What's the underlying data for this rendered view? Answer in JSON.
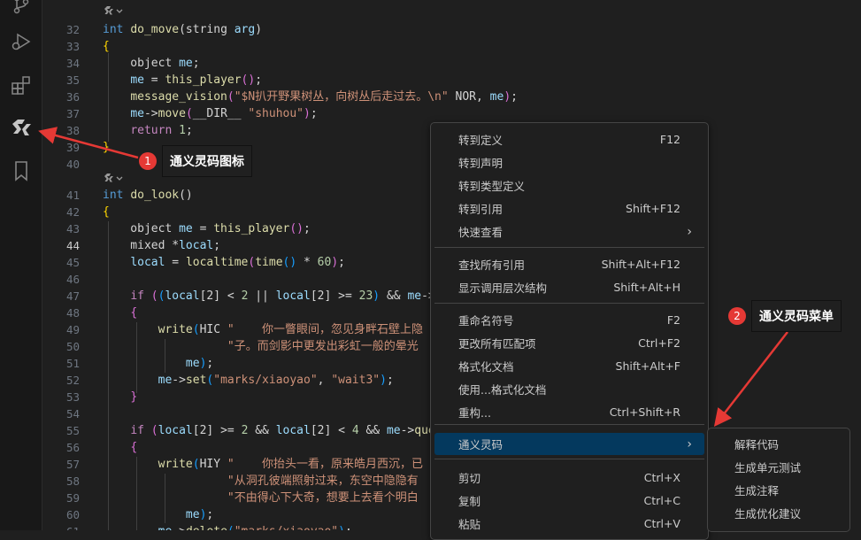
{
  "callouts": [
    {
      "number": "1",
      "text": "通义灵码图标"
    },
    {
      "number": "2",
      "text": "通义灵码菜单"
    }
  ],
  "code": {
    "lines": [
      {
        "n": "",
        "lens": true,
        "tokens": []
      },
      {
        "n": "32",
        "tokens": [
          [
            "int",
            "kw"
          ],
          [
            " ",
            "txt"
          ],
          [
            "do_move",
            "fn"
          ],
          [
            "(string ",
            "txt"
          ],
          [
            "arg",
            "var"
          ],
          [
            ")",
            "txt"
          ]
        ]
      },
      {
        "n": "33",
        "tokens": [
          [
            "{",
            "br"
          ]
        ]
      },
      {
        "n": "34",
        "tokens": [
          [
            "    object ",
            "txt"
          ],
          [
            "me",
            "var"
          ],
          [
            ";",
            "txt"
          ]
        ]
      },
      {
        "n": "35",
        "tokens": [
          [
            "    ",
            "txt"
          ],
          [
            "me",
            "var"
          ],
          [
            " = ",
            "txt"
          ],
          [
            "this_player",
            "fn"
          ],
          [
            "()",
            "br2"
          ],
          [
            ";",
            "txt"
          ]
        ]
      },
      {
        "n": "36",
        "tokens": [
          [
            "    ",
            "txt"
          ],
          [
            "message_vision",
            "fn"
          ],
          [
            "(",
            "br2"
          ],
          [
            "\"$N扒开野果树丛，向树丛后走过去。\\n\"",
            "str"
          ],
          [
            " NOR, ",
            "txt"
          ],
          [
            "me",
            "var"
          ],
          [
            ")",
            "br2"
          ],
          [
            ";",
            "txt"
          ]
        ]
      },
      {
        "n": "37",
        "tokens": [
          [
            "    ",
            "txt"
          ],
          [
            "me",
            "var"
          ],
          [
            "->",
            "txt"
          ],
          [
            "move",
            "fn"
          ],
          [
            "(",
            "br2"
          ],
          [
            "__DIR__ ",
            "txt"
          ],
          [
            "\"shuhou\"",
            "str"
          ],
          [
            ")",
            "br2"
          ],
          [
            ";",
            "txt"
          ]
        ]
      },
      {
        "n": "38",
        "tokens": [
          [
            "    ",
            "txt"
          ],
          [
            "return",
            "pur"
          ],
          [
            " ",
            "txt"
          ],
          [
            "1",
            "num"
          ],
          [
            ";",
            "txt"
          ]
        ]
      },
      {
        "n": "39",
        "tokens": [
          [
            "}",
            "br"
          ]
        ]
      },
      {
        "n": "40",
        "tokens": []
      },
      {
        "n": "",
        "lens": true,
        "tokens": []
      },
      {
        "n": "41",
        "tokens": [
          [
            "int",
            "kw"
          ],
          [
            " ",
            "txt"
          ],
          [
            "do_look",
            "fn"
          ],
          [
            "()",
            "txt"
          ]
        ]
      },
      {
        "n": "42",
        "tokens": [
          [
            "{",
            "br"
          ]
        ]
      },
      {
        "n": "43",
        "tokens": [
          [
            "    object ",
            "txt"
          ],
          [
            "me",
            "var"
          ],
          [
            " = ",
            "txt"
          ],
          [
            "this_player",
            "fn"
          ],
          [
            "()",
            "br2"
          ],
          [
            ";",
            "txt"
          ]
        ]
      },
      {
        "n": "44",
        "active": true,
        "tokens": [
          [
            "    mixed *",
            "txt"
          ],
          [
            "local",
            "var"
          ],
          [
            ";",
            "txt"
          ]
        ]
      },
      {
        "n": "45",
        "tokens": [
          [
            "    ",
            "txt"
          ],
          [
            "local",
            "var"
          ],
          [
            " = ",
            "txt"
          ],
          [
            "localtime",
            "fn"
          ],
          [
            "(",
            "br2"
          ],
          [
            "time",
            "fn"
          ],
          [
            "()",
            "br3"
          ],
          [
            " * ",
            "txt"
          ],
          [
            "60",
            "num"
          ],
          [
            ")",
            "br2"
          ],
          [
            ";",
            "txt"
          ]
        ]
      },
      {
        "n": "46",
        "tokens": []
      },
      {
        "n": "47",
        "tokens": [
          [
            "    ",
            "txt"
          ],
          [
            "if",
            "pur"
          ],
          [
            " ",
            "txt"
          ],
          [
            "(",
            "br2"
          ],
          [
            "(",
            "br3"
          ],
          [
            "local",
            "var"
          ],
          [
            "[2]",
            "txt"
          ],
          [
            " < ",
            "txt"
          ],
          [
            "2",
            "num"
          ],
          [
            " || ",
            "txt"
          ],
          [
            "local",
            "var"
          ],
          [
            "[2]",
            "txt"
          ],
          [
            " >= ",
            "txt"
          ],
          [
            "23",
            "num"
          ],
          [
            ")",
            "br3"
          ],
          [
            " && ",
            "txt"
          ],
          [
            "me",
            "var"
          ],
          [
            "->",
            "txt"
          ]
        ]
      },
      {
        "n": "48",
        "tokens": [
          [
            "    ",
            "txt"
          ],
          [
            "{",
            "br2"
          ]
        ]
      },
      {
        "n": "49",
        "tokens": [
          [
            "        ",
            "txt"
          ],
          [
            "write",
            "fn"
          ],
          [
            "(",
            "br3"
          ],
          [
            "HIC ",
            "txt"
          ],
          [
            "\"    你一瞥眼间，忽见身畔石壁上隐",
            "str"
          ]
        ]
      },
      {
        "n": "50",
        "tokens": [
          [
            "                  ",
            "txt"
          ],
          [
            "\"子。而剑影中更发出彩虹一般的晕光",
            "str"
          ]
        ]
      },
      {
        "n": "51",
        "tokens": [
          [
            "            ",
            "txt"
          ],
          [
            "me",
            "var"
          ],
          [
            ")",
            "br3"
          ],
          [
            ";",
            "txt"
          ]
        ]
      },
      {
        "n": "52",
        "tokens": [
          [
            "        ",
            "txt"
          ],
          [
            "me",
            "var"
          ],
          [
            "->",
            "txt"
          ],
          [
            "set",
            "fn"
          ],
          [
            "(",
            "br3"
          ],
          [
            "\"marks/xiaoyao\"",
            "str"
          ],
          [
            ", ",
            "txt"
          ],
          [
            "\"wait3\"",
            "str"
          ],
          [
            ")",
            "br3"
          ],
          [
            ";",
            "txt"
          ]
        ]
      },
      {
        "n": "53",
        "tokens": [
          [
            "    ",
            "txt"
          ],
          [
            "}",
            "br2"
          ]
        ]
      },
      {
        "n": "54",
        "tokens": []
      },
      {
        "n": "55",
        "tokens": [
          [
            "    ",
            "txt"
          ],
          [
            "if",
            "pur"
          ],
          [
            " ",
            "txt"
          ],
          [
            "(",
            "br2"
          ],
          [
            "local",
            "var"
          ],
          [
            "[2]",
            "txt"
          ],
          [
            " >= ",
            "txt"
          ],
          [
            "2",
            "num"
          ],
          [
            " && ",
            "txt"
          ],
          [
            "local",
            "var"
          ],
          [
            "[2]",
            "txt"
          ],
          [
            " < ",
            "txt"
          ],
          [
            "4",
            "num"
          ],
          [
            " && ",
            "txt"
          ],
          [
            "me",
            "var"
          ],
          [
            "->",
            "txt"
          ],
          [
            "que",
            "fn"
          ]
        ]
      },
      {
        "n": "56",
        "tokens": [
          [
            "    ",
            "txt"
          ],
          [
            "{",
            "br2"
          ]
        ]
      },
      {
        "n": "57",
        "tokens": [
          [
            "        ",
            "txt"
          ],
          [
            "write",
            "fn"
          ],
          [
            "(",
            "br3"
          ],
          [
            "HIY ",
            "txt"
          ],
          [
            "\"    你抬头一看，原来皓月西沉，已",
            "str"
          ]
        ]
      },
      {
        "n": "58",
        "tokens": [
          [
            "                  ",
            "txt"
          ],
          [
            "\"从洞孔彼端照射过来，东空中隐隐有",
            "str"
          ]
        ]
      },
      {
        "n": "59",
        "tokens": [
          [
            "                  ",
            "txt"
          ],
          [
            "\"不由得心下大奇，想要上去看个明白",
            "str"
          ]
        ]
      },
      {
        "n": "60",
        "tokens": [
          [
            "            ",
            "txt"
          ],
          [
            "me",
            "var"
          ],
          [
            ")",
            "br3"
          ],
          [
            ";",
            "txt"
          ]
        ]
      },
      {
        "n": "61",
        "tokens": [
          [
            "        ",
            "txt"
          ],
          [
            "me",
            "var"
          ],
          [
            "->",
            "txt"
          ],
          [
            "delete",
            "fn"
          ],
          [
            "(",
            "br3"
          ],
          [
            "\"marks/xiaoyao\"",
            "str"
          ],
          [
            ")",
            "br3"
          ],
          [
            ";",
            "txt"
          ]
        ]
      }
    ]
  },
  "context_menu": {
    "groups": [
      [
        {
          "label": "转到定义",
          "key": "F12"
        },
        {
          "label": "转到声明",
          "key": ""
        },
        {
          "label": "转到类型定义",
          "key": ""
        },
        {
          "label": "转到引用",
          "key": "Shift+F12"
        },
        {
          "label": "快速查看",
          "key": "",
          "submenu": true
        }
      ],
      [
        {
          "label": "查找所有引用",
          "key": "Shift+Alt+F12"
        },
        {
          "label": "显示调用层次结构",
          "key": "Shift+Alt+H"
        }
      ],
      [
        {
          "label": "重命名符号",
          "key": "F2"
        },
        {
          "label": "更改所有匹配项",
          "key": "Ctrl+F2"
        },
        {
          "label": "格式化文档",
          "key": "Shift+Alt+F"
        },
        {
          "label": "使用...格式化文档",
          "key": ""
        },
        {
          "label": "重构...",
          "key": "Ctrl+Shift+R"
        }
      ],
      [
        {
          "label": "通义灵码",
          "key": "",
          "submenu": true,
          "selected": true
        }
      ],
      [
        {
          "label": "剪切",
          "key": "Ctrl+X"
        },
        {
          "label": "复制",
          "key": "Ctrl+C"
        },
        {
          "label": "粘贴",
          "key": "Ctrl+V"
        }
      ]
    ]
  },
  "submenu": {
    "items": [
      "解释代码",
      "生成单元测试",
      "生成注释",
      "生成优化建议"
    ]
  },
  "colors": {
    "accent_selection": "#04395e",
    "badge": "#e53935",
    "arrow": "#e53935"
  }
}
